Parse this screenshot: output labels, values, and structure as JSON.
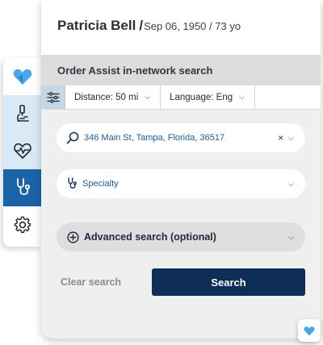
{
  "patient": {
    "name": "Patricia Bell",
    "separator": "/",
    "dob_age": "Sep 06, 1950 / 73 yo"
  },
  "section": {
    "title": "Order Assist in-network search"
  },
  "filters": {
    "toggle_icon": "sliders-icon",
    "distance": "Distance: 50 mi",
    "language": "Language: Eng"
  },
  "location": {
    "value": "346 Main St, Tampa, Florida, 36517",
    "clear_glyph": "×"
  },
  "specialty": {
    "placeholder": "Specialty"
  },
  "advanced": {
    "label": "Advanced search (optional)"
  },
  "actions": {
    "clear": "Clear search",
    "search": "Search"
  },
  "rail": {
    "items": [
      "heart-logo-icon",
      "microscope-icon",
      "heartbeat-icon",
      "stethoscope-icon",
      "gear-icon"
    ],
    "active_index": 3
  },
  "colors": {
    "brand_blue": "#1b63a7",
    "logo_blue": "#4aa6e8",
    "navy": "#0e2d57",
    "link_blue": "#1c5b9a",
    "rail_tint": "#d9e9f5"
  }
}
